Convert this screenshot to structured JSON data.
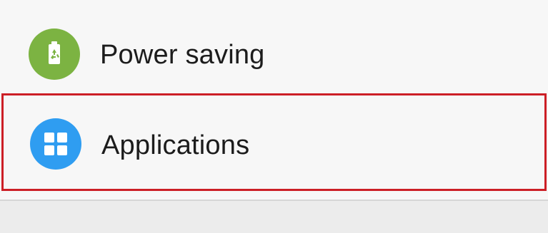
{
  "settings_list": {
    "items": [
      {
        "label": "Power saving",
        "icon": "battery-recycle-icon",
        "icon_color": "#7cb342"
      },
      {
        "label": "Applications",
        "icon": "apps-grid-icon",
        "icon_color": "#2f9df1",
        "highlighted": true,
        "highlight_color": "#cc1f26"
      }
    ]
  }
}
